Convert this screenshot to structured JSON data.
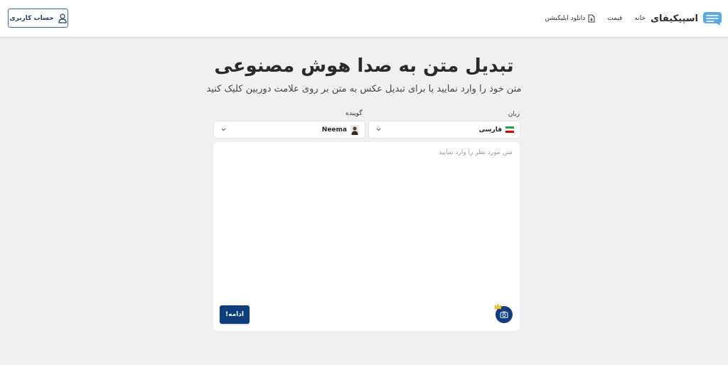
{
  "header": {
    "logo_text": "اسپیکیفای",
    "nav": {
      "home": "خانه",
      "pricing": "قیمت",
      "download": "دانلود اپلیکیشن"
    },
    "account_label": "حساب کاربری"
  },
  "hero": {
    "title": "تبدیل متن به صدا هوش مصنوعی",
    "subtitle": "متن خود را وارد نمایید یا برای تبدیل عکس به متن بر روی علامت دوربین کلیک کنید"
  },
  "form": {
    "language_label": "زبان",
    "language_value": "فارسی",
    "speaker_label": "گوینده",
    "speaker_value": "Neema",
    "textarea_placeholder": "متن مورد نظر را وارد نمایید",
    "textarea_value": "",
    "continue_label": "ادامه!"
  },
  "colors": {
    "primary": "#0d3f7e",
    "page_bg": "#f0f0f3",
    "logo_accent": "#5aa9e6"
  },
  "icons": {
    "account": "user-icon",
    "download": "download-app-icon",
    "logo": "logo-icon",
    "chevron": "chevron-down-icon",
    "camera": "camera-icon",
    "premium": "crown-icon",
    "flag": "iran-flag-icon"
  }
}
